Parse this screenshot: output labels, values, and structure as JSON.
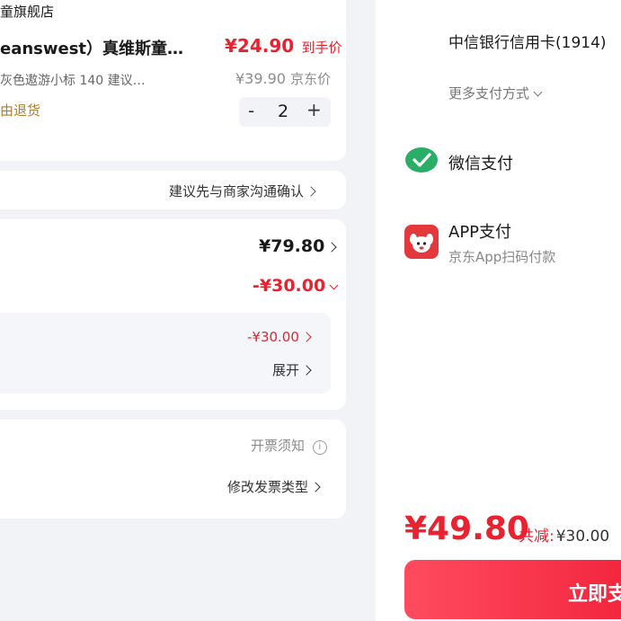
{
  "product": {
    "store_name": "童旗舰店",
    "title": "eanswest）真维斯童…",
    "spec": "灰色遨游小标   140 建议…",
    "price_final": "¥24.90",
    "price_final_label": "到手价",
    "price_jd": "¥39.90",
    "price_jd_label": "京东价",
    "tag": "由退货",
    "quantity": "2",
    "minus": "-",
    "plus": "+"
  },
  "note": {
    "text": "建议先与商家沟通确认"
  },
  "amounts": {
    "subtotal": "¥79.80",
    "discount": "-¥30.00",
    "coupon_value": "-¥30.00",
    "expand_label": "展开"
  },
  "invoice": {
    "notice": "开票须知",
    "modify": "修改发票类型"
  },
  "payment": {
    "card_label": "中信银行信用卡(1914)",
    "more_methods": "更多支付方式",
    "wechat_label": "微信支付",
    "app_label": "APP支付",
    "app_sub": "京东App扫码付款"
  },
  "footer": {
    "total": "¥49.80",
    "saved_label": "共减:",
    "saved_value": "¥30.00",
    "pay_button": "立即支"
  },
  "colors": {
    "accent_red": "#e8222e",
    "wechat_green": "#2aae67",
    "jd_red": "#e4393c"
  }
}
